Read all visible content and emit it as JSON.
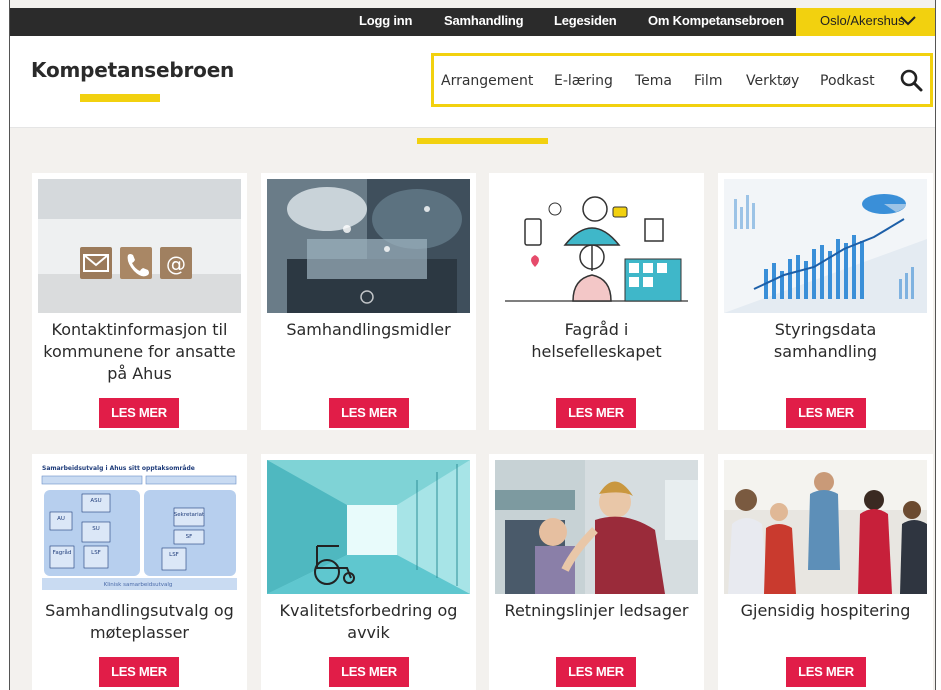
{
  "topbar": {
    "links": [
      "Logg inn",
      "Samhandling",
      "Legesiden",
      "Om Kompetansebroen"
    ],
    "region": "Oslo/Akershus",
    "region_icon": "chevron-down-icon"
  },
  "header": {
    "site_title": "Kompetansebroen",
    "nav": [
      "Arrangement",
      "E-læring",
      "Tema",
      "Film",
      "Verktøy",
      "Podkast"
    ],
    "search_icon": "search-icon"
  },
  "colors": {
    "accent_yellow": "#f2d10f",
    "button_red": "#e11d48",
    "topbar": "#2b2b2b",
    "background": "#f3f1ee"
  },
  "cards": [
    {
      "title": "Kontaktinformasjon til kommunene for ansatte på Ahus",
      "button": "LES MER"
    },
    {
      "title": "Samhandlingsmidler",
      "button": "LES MER"
    },
    {
      "title": "Fagråd i helsefelleskapet",
      "button": "LES MER"
    },
    {
      "title": "Styringsdata samhandling",
      "button": "LES MER"
    },
    {
      "title": "Samhandlingsutvalg og møteplasser",
      "button": "LES MER"
    },
    {
      "title": "Kvalitetsforbedring og avvik",
      "button": "LES MER"
    },
    {
      "title": "Retningslinjer ledsager",
      "button": "LES MER"
    },
    {
      "title": "Gjensidig hospitering",
      "button": "LES MER"
    }
  ],
  "card5_image_text": {
    "heading": "Samarbeidsutvalg i Ahus sitt opptaksområde",
    "boxes": [
      "ASU",
      "AU",
      "SU",
      "Fagråd",
      "LSF",
      "Sekretariat",
      "SF",
      "LSF",
      "Klinisk samarbeidsutvalg"
    ]
  }
}
